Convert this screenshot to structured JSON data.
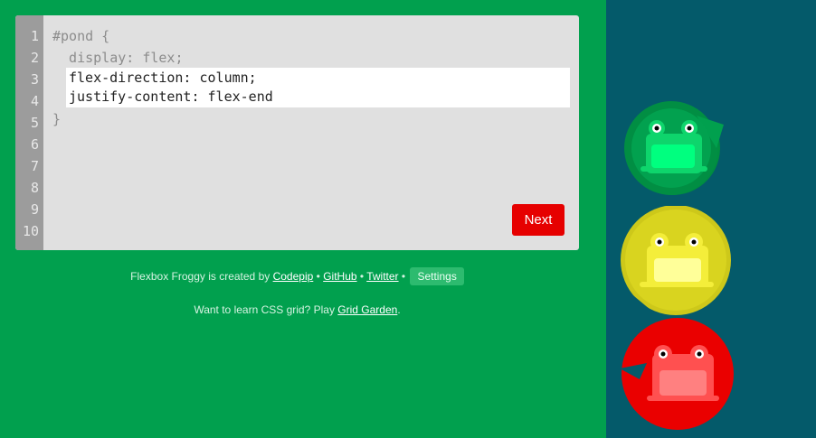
{
  "editor": {
    "line_numbers": [
      "1",
      "2",
      "3",
      "4",
      "5",
      "6",
      "7",
      "8",
      "9",
      "10"
    ],
    "line1": "#pond {",
    "line2": "  display: flex;",
    "input_text": "flex-direction: column;\njustify-content: flex-end",
    "line5": "}",
    "next_label": "Next"
  },
  "footer": {
    "credit_prefix": "Flexbox Froggy is created by",
    "codepip": "Codepip",
    "bullet": "•",
    "github": "GitHub",
    "twitter": "Twitter",
    "settings": "Settings",
    "grid_prefix": "Want to learn CSS grid? Play",
    "grid_link": "Grid Garden",
    "grid_suffix": "."
  },
  "pond": {
    "background": "#045a6a",
    "frogs": [
      {
        "color": "green",
        "lily": "#01a04e",
        "body": "#0ed56c",
        "belly": "#00ff7f"
      },
      {
        "color": "yellow",
        "lily": "#cdc81a",
        "body": "#f4ee3a",
        "belly": "#ffff99"
      },
      {
        "color": "red",
        "lily": "#ea0000",
        "body": "#ff5050",
        "belly": "#ff8080"
      }
    ]
  }
}
